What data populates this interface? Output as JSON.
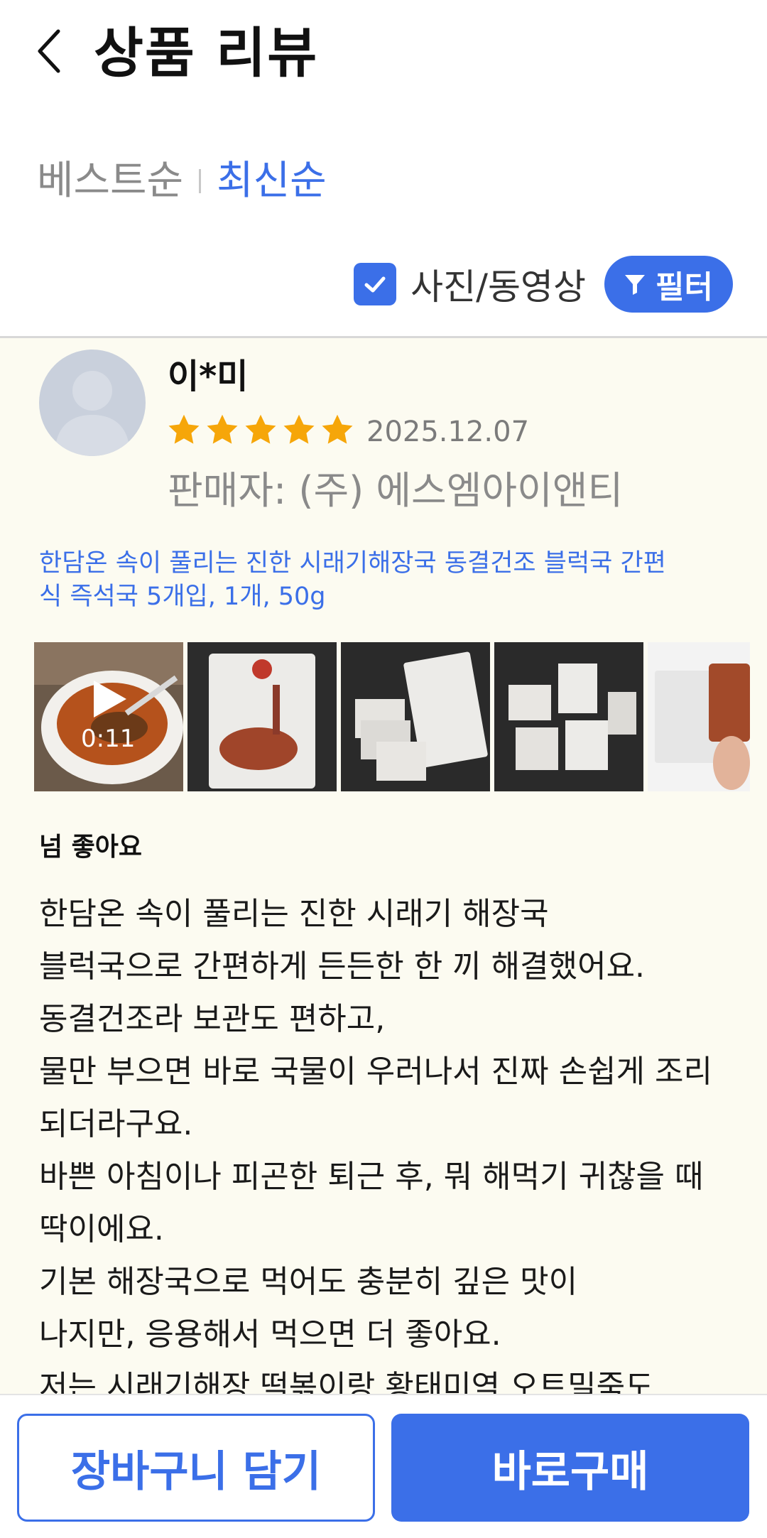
{
  "header": {
    "title": "상품 리뷰",
    "back_icon": "chevron-left-icon"
  },
  "sort": {
    "tabs": [
      {
        "label": "베스트순",
        "active": false
      },
      {
        "label": "최신순",
        "active": true
      }
    ]
  },
  "filter": {
    "photo_video_label": "사진/동영상",
    "photo_video_checked": true,
    "filter_label": "필터",
    "filter_icon": "funnel-icon"
  },
  "review": {
    "reviewer": "이*미",
    "rating": 5,
    "rating_max": 5,
    "date": "2025.12.07",
    "seller": "판매자: (주) 에스엠아이앤티",
    "product_option": "한담온 속이 풀리는 진한 시래기해장국 동결건조 블럭국 간편식 즉석국 5개입, 1개, 50g",
    "video_duration": "0:11",
    "title": "넘 좋아요",
    "body": "한담온 속이 풀리는 진한 시래기 해장국\n블럭국으로 간편하게 든든한 한 끼 해결했어요.\n동결건조라 보관도 편하고,\n물만 부으면 바로 국물이 우러나서 진짜 손쉽게 조리되더라구요.\n바쁜 아침이나 피곤한 퇴근 후, 뭐 해먹기 귀찮을 때 딱이에요.\n기본 해장국으로 먹어도 충분히 깊은 맛이\n나지만, 응용해서 먹으면 더 좋아요.\n저는 시래기해장 떡볶이랑 황태미역 오트밀죽도"
  },
  "actions": {
    "cart_label": "장바구니 담기",
    "buy_label": "바로구매"
  },
  "colors": {
    "accent": "#3b6fe8",
    "star": "#f6a609",
    "review_bg": "#fcfbf1"
  }
}
